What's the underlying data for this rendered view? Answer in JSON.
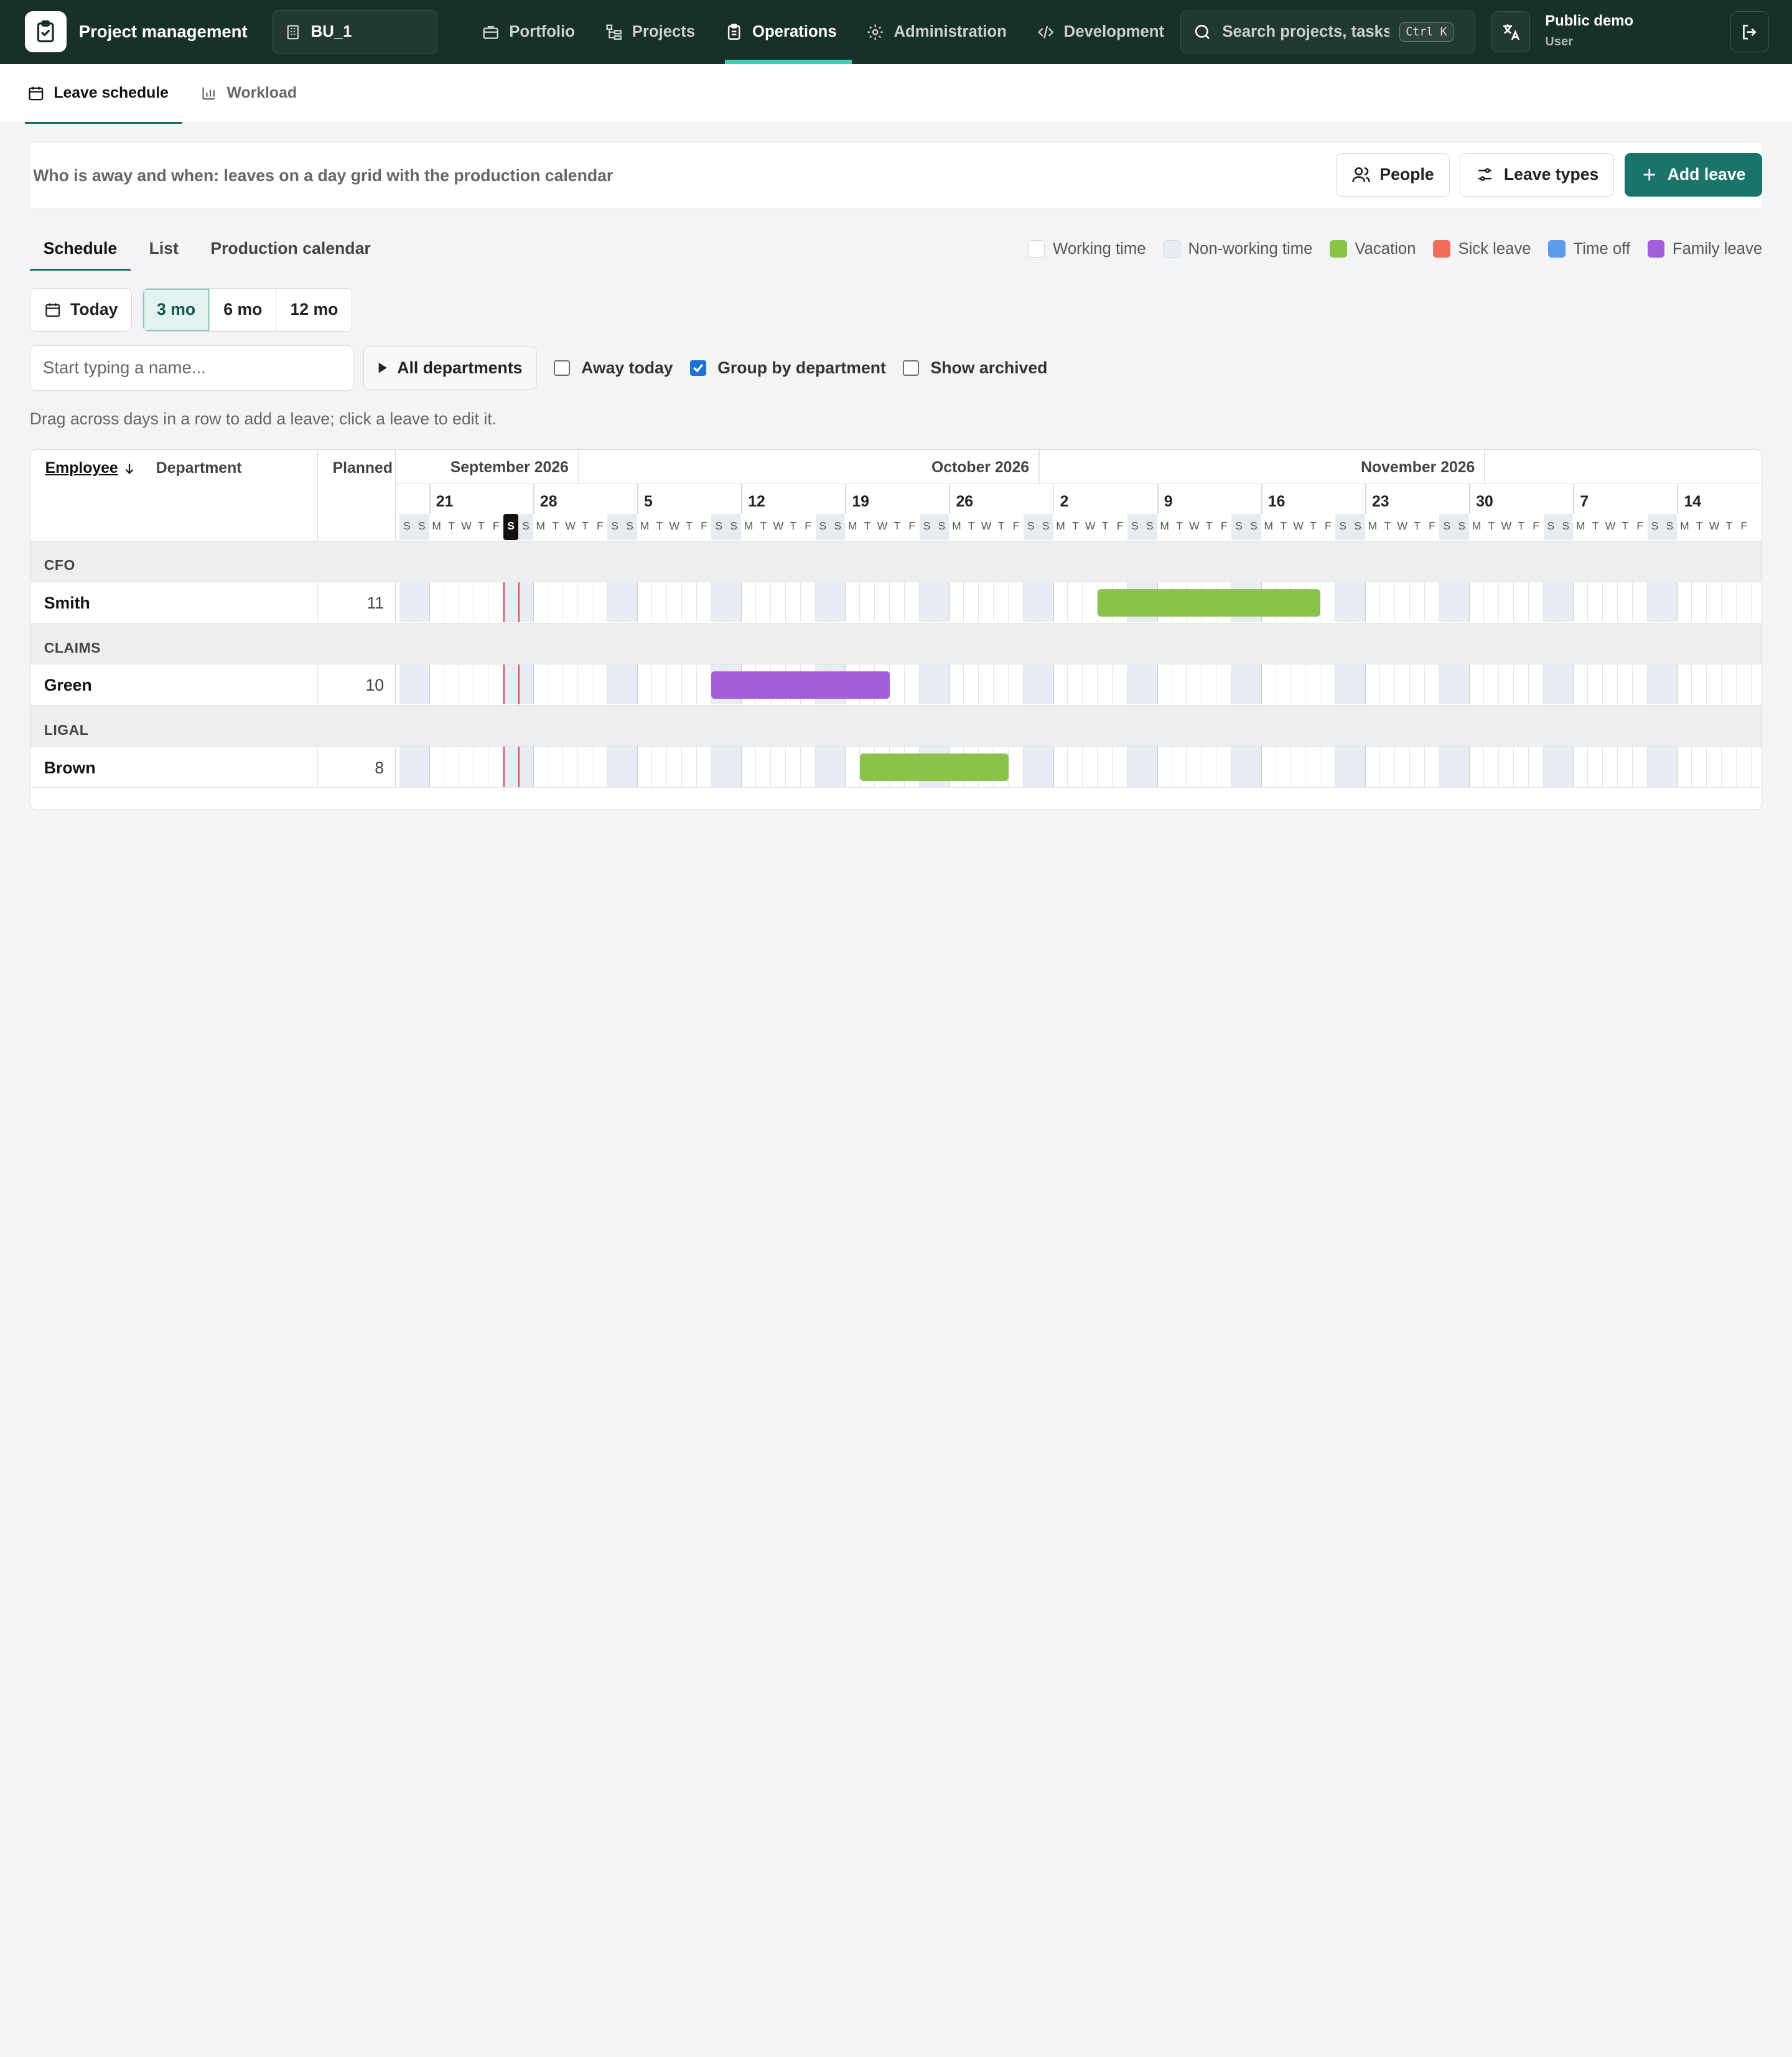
{
  "app": {
    "title": "Project management",
    "business_unit": "BU_1"
  },
  "nav": [
    {
      "label": "Portfolio",
      "icon": "briefcase-icon",
      "active": false
    },
    {
      "label": "Projects",
      "icon": "hierarchy-icon",
      "active": false
    },
    {
      "label": "Operations",
      "icon": "clipboard-icon",
      "active": true
    },
    {
      "label": "Administration",
      "icon": "gear-icon",
      "active": false
    },
    {
      "label": "Development",
      "icon": "code-icon",
      "active": false
    }
  ],
  "search": {
    "placeholder": "Search projects, tasks",
    "shortcut": "Ctrl K"
  },
  "user": {
    "name": "Public demo",
    "role": "User"
  },
  "subtabs": [
    {
      "label": "Leave schedule",
      "icon": "calendar-icon",
      "active": true
    },
    {
      "label": "Workload",
      "icon": "bar-chart-icon",
      "active": false
    }
  ],
  "header": {
    "description": "Who is away and when: leaves on a day grid with the production calendar",
    "people_label": "People",
    "leave_types_label": "Leave types",
    "add_leave_label": "Add leave"
  },
  "view_tabs": [
    {
      "label": "Schedule",
      "active": true
    },
    {
      "label": "List",
      "active": false
    },
    {
      "label": "Production calendar",
      "active": false
    }
  ],
  "legend": [
    {
      "label": "Working time",
      "color": "#ffffff"
    },
    {
      "label": "Non-working time",
      "color": "#e9edf3"
    },
    {
      "label": "Vacation",
      "color": "#8bc34a"
    },
    {
      "label": "Sick leave",
      "color": "#f26b5b"
    },
    {
      "label": "Time off",
      "color": "#5b9bea"
    },
    {
      "label": "Family leave",
      "color": "#a25fd8"
    }
  ],
  "range": {
    "today_label": "Today",
    "options": [
      {
        "label": "3 mo",
        "active": true
      },
      {
        "label": "6 mo",
        "active": false
      },
      {
        "label": "12 mo",
        "active": false
      }
    ]
  },
  "filters": {
    "name_placeholder": "Start typing a name...",
    "departments_label": "All departments",
    "checks": [
      {
        "label": "Away today",
        "checked": false
      },
      {
        "label": "Group by department",
        "checked": true
      },
      {
        "label": "Show archived",
        "checked": false
      }
    ]
  },
  "hint": "Drag across days in a row to add a leave; click a leave to edit it.",
  "grid": {
    "col_employee": "Employee",
    "col_department": "Department",
    "col_planned": "Planned",
    "start_date": "2026-09-19",
    "today": "2026-09-26",
    "months": [
      "September 2026",
      "October 2026",
      "November 2026"
    ],
    "weeks": [
      "21",
      "28",
      "5",
      "12",
      "19",
      "26",
      "2",
      "9",
      "16",
      "23",
      "30",
      "7",
      "14"
    ],
    "day_letters": [
      "S",
      "S",
      "M",
      "T",
      "W",
      "T",
      "F",
      "S",
      "S",
      "M",
      "T",
      "W",
      "T",
      "F",
      "S",
      "S",
      "M",
      "T",
      "W",
      "T",
      "F",
      "S",
      "S",
      "M",
      "T",
      "W",
      "T",
      "F",
      "S",
      "S",
      "M",
      "T",
      "W",
      "T",
      "F",
      "S",
      "S",
      "M",
      "T",
      "W",
      "T",
      "F",
      "S",
      "S",
      "M",
      "T",
      "W",
      "T",
      "F",
      "S",
      "S",
      "M",
      "T",
      "W",
      "T",
      "F",
      "S",
      "S",
      "M",
      "T",
      "W",
      "T",
      "F",
      "S",
      "S",
      "M",
      "T",
      "W",
      "T",
      "F",
      "S",
      "S",
      "M",
      "T",
      "W",
      "T",
      "F",
      "S",
      "S",
      "M",
      "T",
      "W",
      "T",
      "F",
      "S",
      "S",
      "M",
      "T",
      "W",
      "T",
      "F"
    ],
    "groups": [
      {
        "name": "CFO",
        "employees": [
          {
            "name": "Smith",
            "planned": "11",
            "leaves": [
              {
                "type": "Vacation",
                "start": "2026-11-05",
                "end": "2026-11-19"
              }
            ]
          }
        ]
      },
      {
        "name": "CLAIMS",
        "employees": [
          {
            "name": "Green",
            "planned": "10",
            "leaves": [
              {
                "type": "Family leave",
                "start": "2026-10-10",
                "end": "2026-10-21"
              }
            ]
          }
        ]
      },
      {
        "name": "LIGAL",
        "employees": [
          {
            "name": "Brown",
            "planned": "8",
            "leaves": [
              {
                "type": "Vacation",
                "start": "2026-10-20",
                "end": "2026-10-29"
              }
            ]
          }
        ]
      }
    ]
  }
}
